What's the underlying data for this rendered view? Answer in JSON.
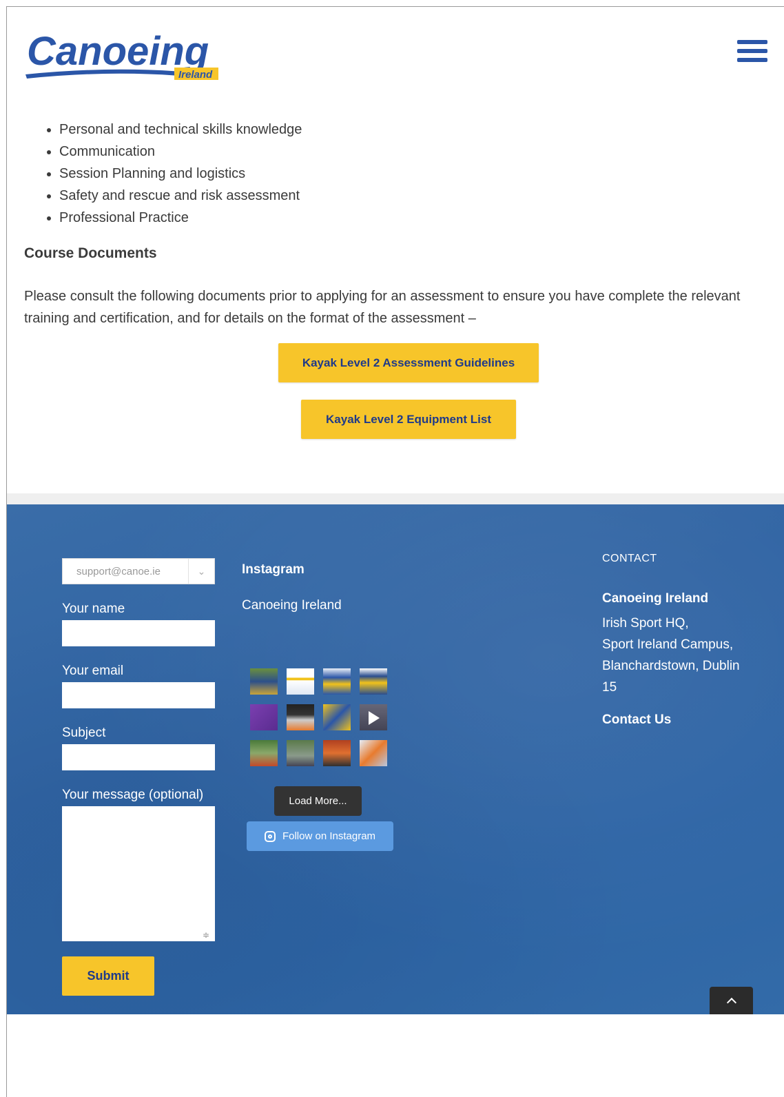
{
  "header": {
    "logo_text": "Canoeing",
    "logo_subtext": "Ireland",
    "menu_icon": "hamburger-menu-icon"
  },
  "content": {
    "bullets": [
      "Personal and technical skills knowledge",
      "Communication",
      "Session Planning and logistics",
      "Safety and rescue and risk assessment",
      "Professional Practice"
    ],
    "docs_heading": "Course Documents",
    "intro": "Please consult the following documents prior to applying for an assessment to ensure you have complete the relevant training and certification, and for details on the format of the assessment –",
    "btn_guidelines": "Kayak Level 2 Assessment Guidelines",
    "btn_equipment": "Kayak Level 2 Equipment List"
  },
  "form": {
    "select_value": "support@canoe.ie",
    "label_name": "Your name",
    "label_email": "Your email",
    "label_subject": "Subject",
    "label_message": "Your message (optional)",
    "submit": "Submit"
  },
  "instagram": {
    "title": "Instagram",
    "account": "Canoeing Ireland",
    "load_more": "Load More...",
    "follow": "Follow on Instagram"
  },
  "contact": {
    "heading": "CONTACT",
    "org": "Canoeing Ireland",
    "address_lines": [
      "Irish Sport HQ,",
      "Sport Ireland Campus,",
      "Blanchardstown, Dublin",
      "15"
    ],
    "contact_link": "Contact Us"
  },
  "colors": {
    "brand_blue": "#2b56a8",
    "accent_yellow": "#f7c52a",
    "footer_blue": "#2f63a3"
  }
}
